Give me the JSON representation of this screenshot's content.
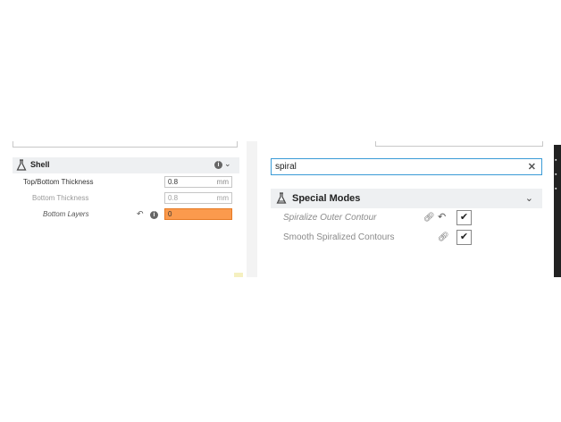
{
  "left": {
    "section": {
      "title": "Shell",
      "icon": "flask-icon"
    },
    "rows": [
      {
        "label": "Top/Bottom Thickness",
        "value": "0.8",
        "unit": "mm"
      },
      {
        "label": "Bottom Thickness",
        "value": "0.8",
        "unit": "mm"
      },
      {
        "label": "Bottom Layers",
        "value": "0"
      }
    ]
  },
  "right": {
    "search": {
      "value": "spiral",
      "clear_icon": "close-icon"
    },
    "category": {
      "title": "Special Modes",
      "icon": "flask-icon"
    },
    "settings": [
      {
        "label": "Spiralize Outer Contour",
        "checked": true
      },
      {
        "label": "Smooth Spiralized Contours",
        "checked": true
      }
    ]
  },
  "colors": {
    "accent": "#3a9bd6",
    "error": "#fb9a4d",
    "header_bg": "#eef0f2"
  }
}
